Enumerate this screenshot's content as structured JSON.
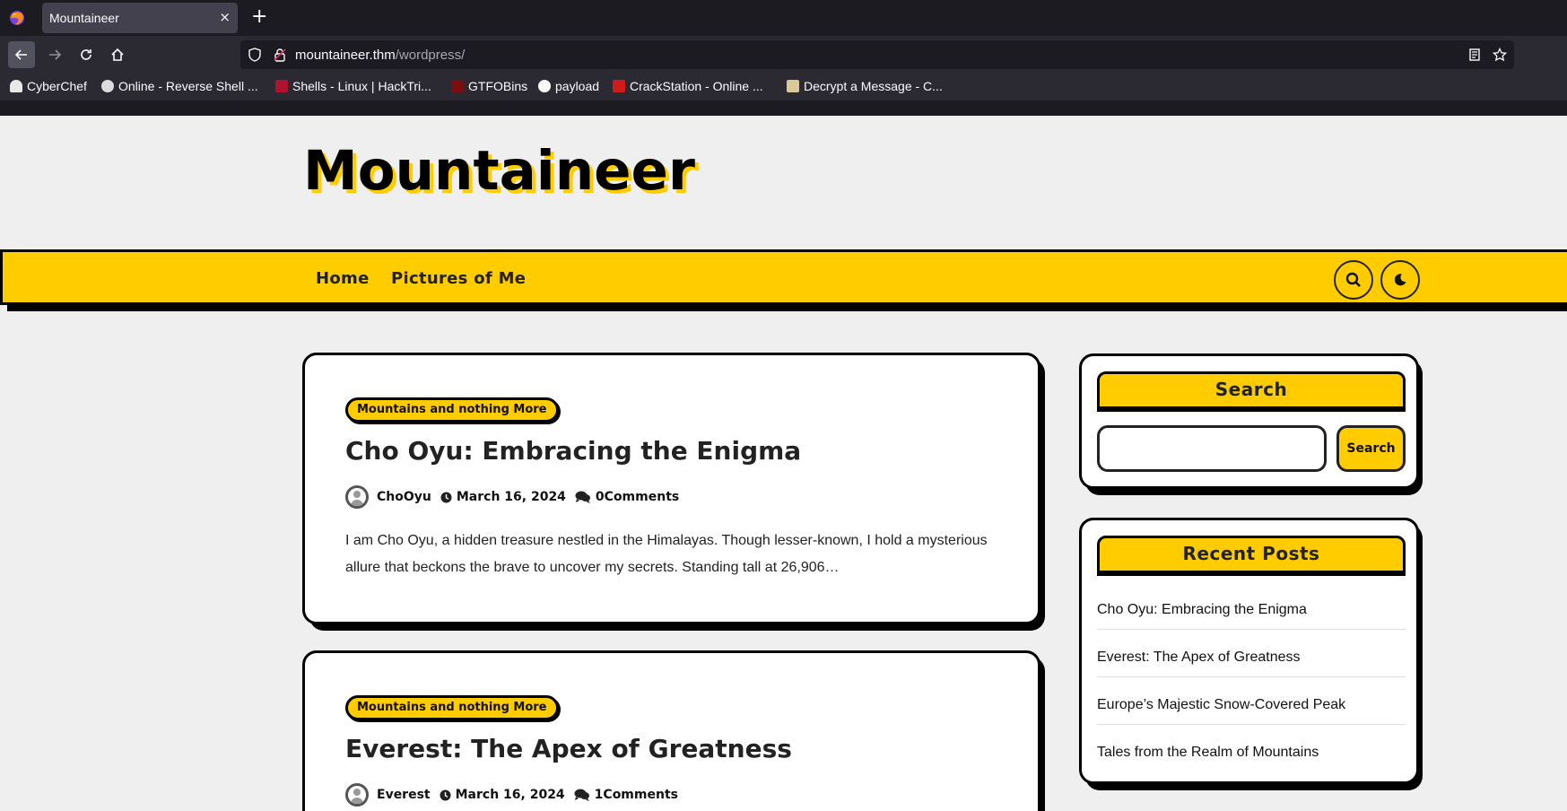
{
  "browser": {
    "tab_title": "Mountaineer",
    "close_glyph": "×",
    "new_tab_glyph": "+",
    "url_host": "mountaineer.thm",
    "url_path": "/wordpress/",
    "bookmarks": [
      {
        "label": "CyberChef",
        "icon": "chef-hat-icon"
      },
      {
        "label": "Online - Reverse Shell ...",
        "icon": "skull-icon"
      },
      {
        "label": "Shells - Linux | HackTri...",
        "icon": "hacktricks-icon"
      },
      {
        "label": "GTFOBins",
        "icon": "gtfobins-icon"
      },
      {
        "label": "payload",
        "icon": "github-icon"
      },
      {
        "label": "CrackStation - Online ...",
        "icon": "crackstation-icon"
      },
      {
        "label": "Decrypt a Message - C...",
        "icon": "envelope-icon"
      }
    ]
  },
  "site": {
    "title": "Mountaineer",
    "menu": [
      "Home",
      "Pictures of Me"
    ]
  },
  "posts": [
    {
      "category": "Mountains and nothing More",
      "title": "Cho Oyu: Embracing the Enigma",
      "author": "ChoOyu",
      "date": "March 16, 2024",
      "comments": "0Comments",
      "excerpt": "I am Cho Oyu, a hidden treasure nestled in the Himalayas. Though lesser-known, I hold a mysterious allure that beckons the brave to uncover my secrets. Standing tall at 26,906…"
    },
    {
      "category": "Mountains and nothing More",
      "title": "Everest: The Apex of Greatness",
      "author": "Everest",
      "date": "March 16, 2024",
      "comments": "1Comments"
    }
  ],
  "sidebar": {
    "search": {
      "title": "Search",
      "button": "Search",
      "value": ""
    },
    "recent": {
      "title": "Recent Posts",
      "items": [
        "Cho Oyu: Embracing the Enigma",
        "Everest: The Apex of Greatness",
        "Europe’s Majestic Snow-Covered Peak",
        "Tales from the Realm of Mountains"
      ]
    }
  },
  "colors": {
    "accent": "#ffcc00",
    "ink": "#000000",
    "page_bg": "#efefef"
  }
}
